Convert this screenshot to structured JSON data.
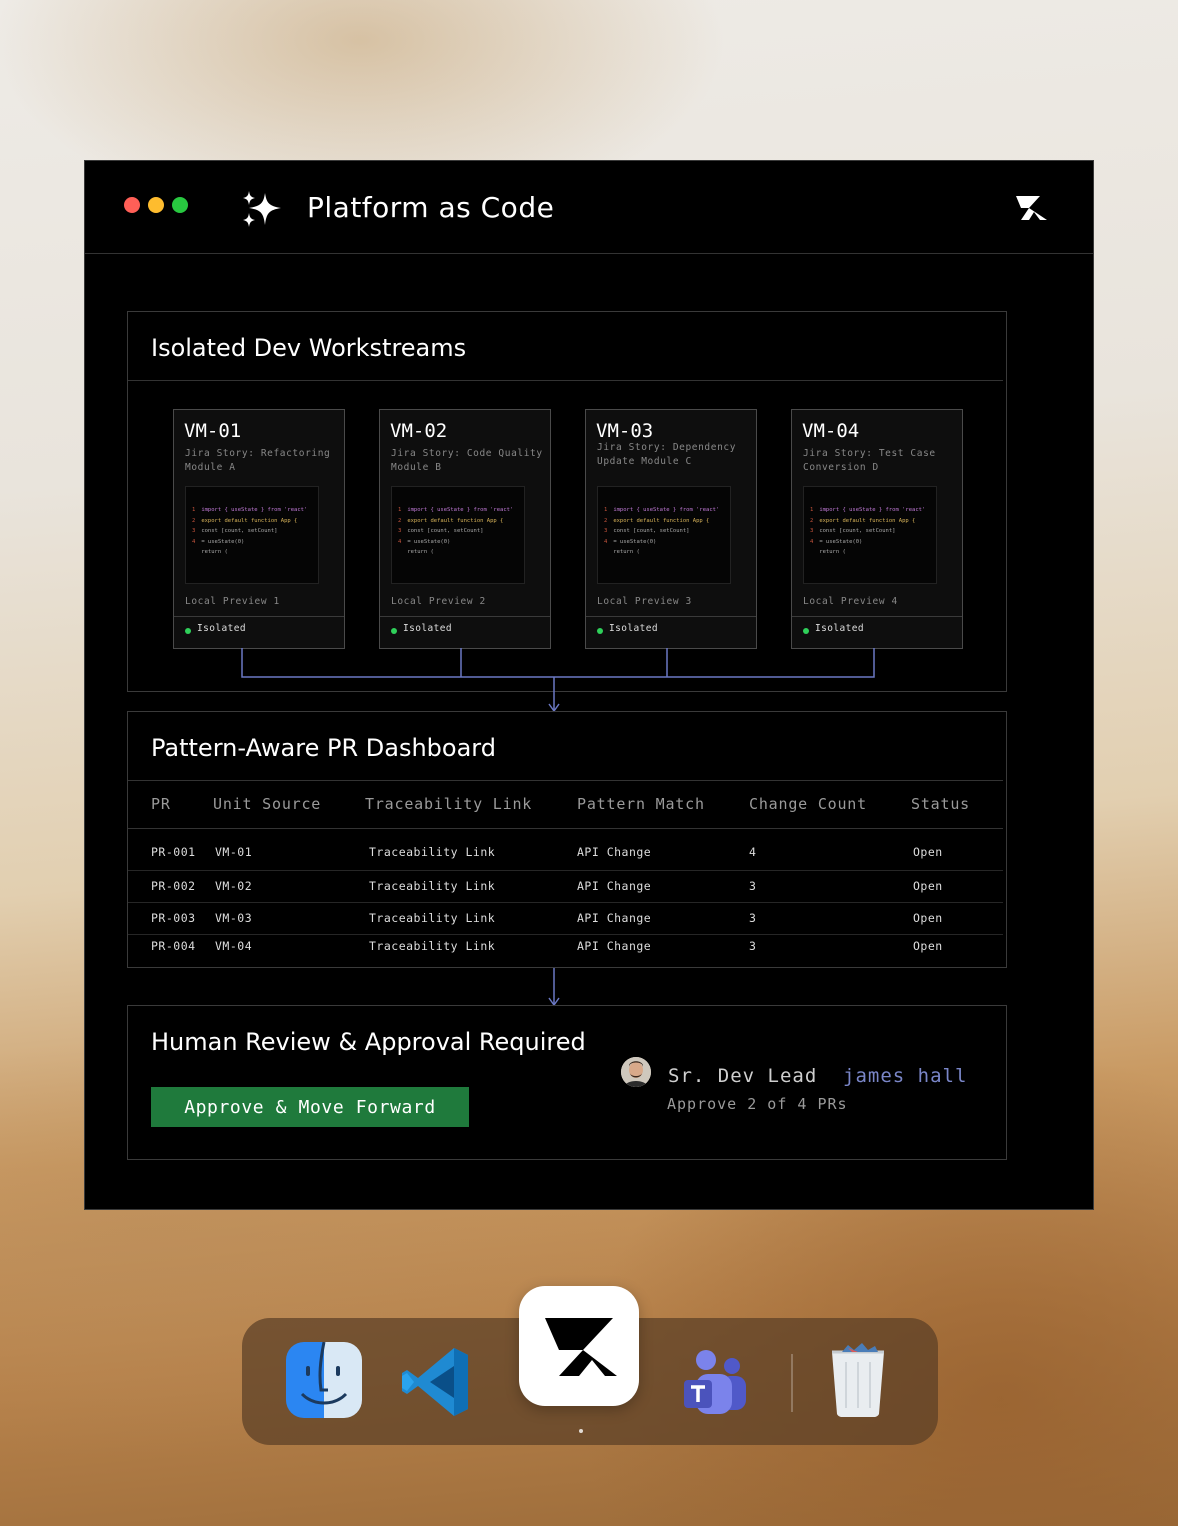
{
  "window": {
    "title": "Platform as Code"
  },
  "workstreams": {
    "title": "Isolated Dev Workstreams",
    "code_lines": [
      "import { useState } from 'react'",
      "export default function App {",
      "const [count, setCount]",
      "= useState(0)",
      "return ("
    ],
    "vms": [
      {
        "name": "VM-01",
        "story": "Jira Story: Refactoring Module A",
        "preview": "Local Preview 1",
        "status": "Isolated"
      },
      {
        "name": "VM-02",
        "story": "Jira Story: Code Quality Module B",
        "preview": "Local Preview 2",
        "status": "Isolated"
      },
      {
        "name": "VM-03",
        "story": "Jira Story: Dependency Update Module C",
        "preview": "Local Preview 3",
        "status": "Isolated"
      },
      {
        "name": "VM-04",
        "story": "Jira Story: Test Case Conversion D",
        "preview": "Local Preview 4",
        "status": "Isolated"
      }
    ]
  },
  "dashboard": {
    "title": "Pattern-Aware PR Dashboard",
    "columns": [
      "PR",
      "Unit Source",
      "Traceability Link",
      "Pattern Match",
      "Change Count",
      "Status"
    ],
    "rows": [
      {
        "pr": "PR-001",
        "source": "VM-01",
        "link": "Traceability Link",
        "pattern": "API Change",
        "count": "4",
        "status": "Open"
      },
      {
        "pr": "PR-002",
        "source": "VM-02",
        "link": "Traceability Link",
        "pattern": "API Change",
        "count": "3",
        "status": "Open"
      },
      {
        "pr": "PR-003",
        "source": "VM-03",
        "link": "Traceability Link",
        "pattern": "API Change",
        "count": "3",
        "status": "Open"
      },
      {
        "pr": "PR-004",
        "source": "VM-04",
        "link": "Traceability Link",
        "pattern": "API Change",
        "count": "3",
        "status": "Open"
      }
    ]
  },
  "review": {
    "title": "Human Review & Approval Required",
    "button_label": "Approve & Move Forward",
    "role": "Sr. Dev Lead",
    "person": "james hall",
    "approval_text": "Approve 2 of 4 PRs"
  },
  "dock": {
    "apps": [
      "finder-icon",
      "vscode-icon",
      "platform-app-icon",
      "teams-icon",
      "trash-icon"
    ]
  },
  "colors": {
    "accent_green": "#1f7a3c",
    "connector": "#6b78c4",
    "status_green": "#2fd05a",
    "name_blue": "#7a86c8"
  }
}
